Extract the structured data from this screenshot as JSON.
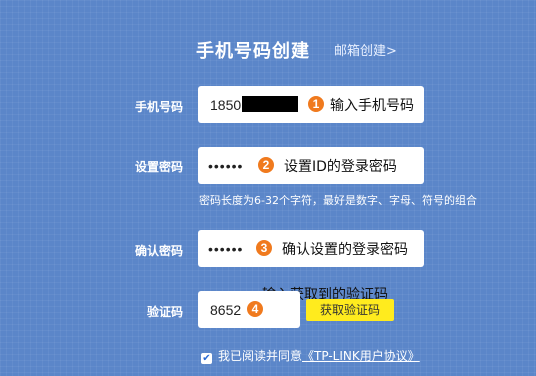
{
  "header": {
    "title": "手机号码创建",
    "switch_link": "邮箱创建>"
  },
  "form": {
    "phone": {
      "label": "手机号码",
      "value": "1850",
      "annotation_number": "1",
      "annotation": "输入手机号码"
    },
    "password": {
      "label": "设置密码",
      "value": "••••••",
      "annotation_number": "2",
      "annotation": "设置ID的登录密码",
      "hint": "密码长度为6-32个字符，最好是数字、字母、符号的组合"
    },
    "confirm": {
      "label": "确认密码",
      "value": "••••••",
      "annotation_number": "3",
      "annotation": "确认设置的登录密码"
    },
    "code": {
      "label": "验证码",
      "value": "8652",
      "annotation_number": "4",
      "annotation": "输入获取到的验证码",
      "button": "获取验证码"
    },
    "agreement": {
      "checked": true,
      "check_glyph": "✔",
      "text": "我已阅读并同意",
      "link": "《TP-LINK用户协议》"
    }
  },
  "colors": {
    "background": "#5b86c9",
    "badge": "#f07a1e",
    "code_button": "#ffeb1e"
  }
}
